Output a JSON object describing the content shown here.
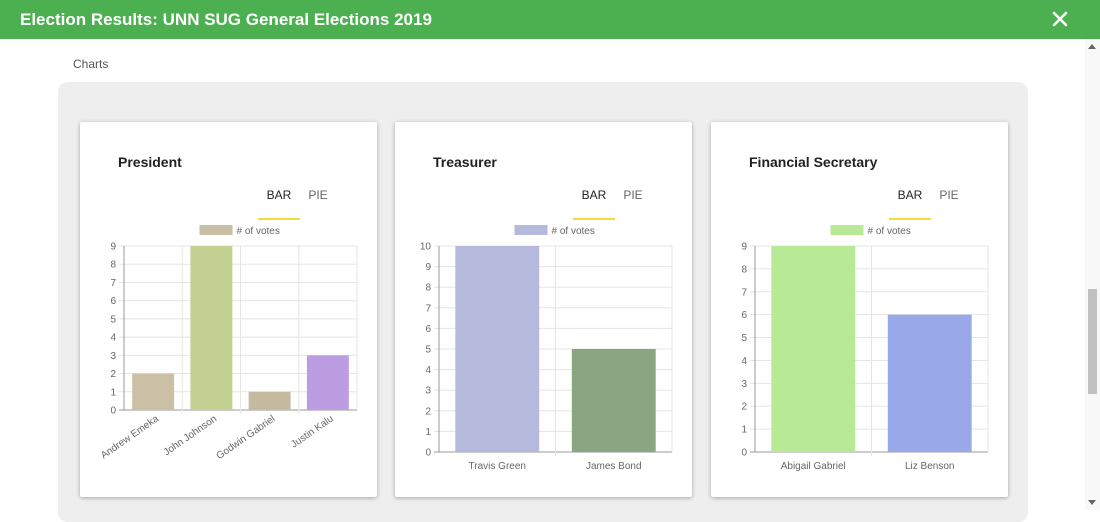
{
  "header": {
    "title": "Election Results: UNN SUG General Elections 2019"
  },
  "section": {
    "label": "Charts"
  },
  "tabs": {
    "bar": "BAR",
    "pie": "PIE"
  },
  "charts": [
    {
      "title": "President",
      "chart_data": {
        "type": "bar",
        "legend": "# of votes",
        "legend_color": "#c8bfa7",
        "categories": [
          "Andrew Emeka",
          "John Johnson",
          "Godwin Gabriel",
          "Justin Kalu"
        ],
        "values": [
          2,
          9,
          1,
          3
        ],
        "colors": [
          "#cbbfa6",
          "#c2d192",
          "#c5b99f",
          "#bd9de2"
        ],
        "ylim": [
          0,
          9
        ],
        "yticks": [
          0,
          1,
          2,
          3,
          4,
          5,
          6,
          7,
          8,
          9
        ],
        "rotate_labels": true
      }
    },
    {
      "title": "Treasurer",
      "chart_data": {
        "type": "bar",
        "legend": "# of votes",
        "legend_color": "#b5badc",
        "categories": [
          "Travis Green",
          "James Bond"
        ],
        "values": [
          10,
          5
        ],
        "colors": [
          "#b5badc",
          "#8aa680"
        ],
        "ylim": [
          0,
          10
        ],
        "yticks": [
          0,
          1,
          2,
          3,
          4,
          5,
          6,
          7,
          8,
          9,
          10
        ],
        "rotate_labels": false
      }
    },
    {
      "title": "Financial Secretary",
      "chart_data": {
        "type": "bar",
        "legend": "# of votes",
        "legend_color": "#b8e997",
        "categories": [
          "Abigail Gabriel",
          "Liz Benson"
        ],
        "values": [
          9,
          6
        ],
        "colors": [
          "#b8e997",
          "#98a8e8"
        ],
        "ylim": [
          0,
          9
        ],
        "yticks": [
          0,
          1,
          2,
          3,
          4,
          5,
          6,
          7,
          8,
          9
        ],
        "rotate_labels": false
      }
    }
  ]
}
